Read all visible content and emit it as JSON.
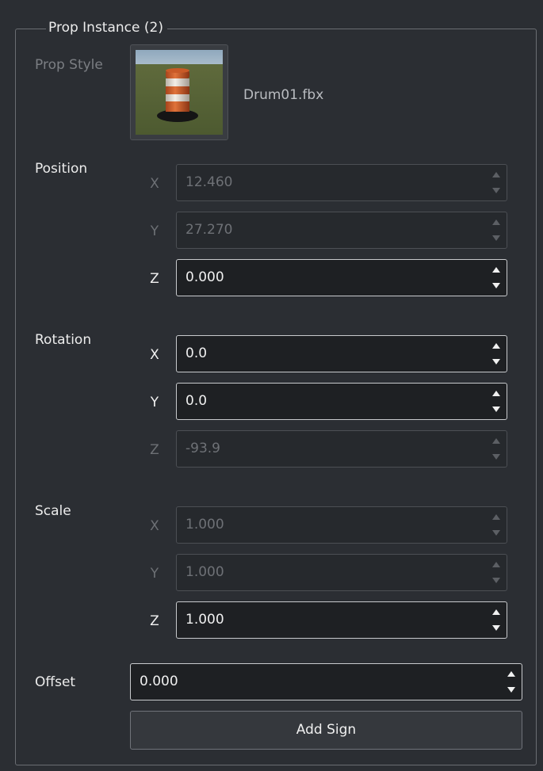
{
  "group": {
    "title": "Prop Instance (2)"
  },
  "prop_style": {
    "label": "Prop Style",
    "file_name": "Drum01.fbx",
    "thumbnail": "traffic-drum-thumbnail"
  },
  "position": {
    "label": "Position",
    "x": {
      "axis": "X",
      "value": "12.460",
      "enabled": false
    },
    "y": {
      "axis": "Y",
      "value": "27.270",
      "enabled": false
    },
    "z": {
      "axis": "Z",
      "value": "0.000",
      "enabled": true
    }
  },
  "rotation": {
    "label": "Rotation",
    "x": {
      "axis": "X",
      "value": "0.0",
      "enabled": true
    },
    "y": {
      "axis": "Y",
      "value": "0.0",
      "enabled": true
    },
    "z": {
      "axis": "Z",
      "value": "-93.9",
      "enabled": false
    }
  },
  "scale": {
    "label": "Scale",
    "x": {
      "axis": "X",
      "value": "1.000",
      "enabled": false
    },
    "y": {
      "axis": "Y",
      "value": "1.000",
      "enabled": false
    },
    "z": {
      "axis": "Z",
      "value": "1.000",
      "enabled": true
    }
  },
  "offset": {
    "label": "Offset",
    "value": "0.000"
  },
  "add_sign_label": "Add Sign",
  "icons": {
    "spin_up": "triangle-up",
    "spin_down": "triangle-down"
  }
}
